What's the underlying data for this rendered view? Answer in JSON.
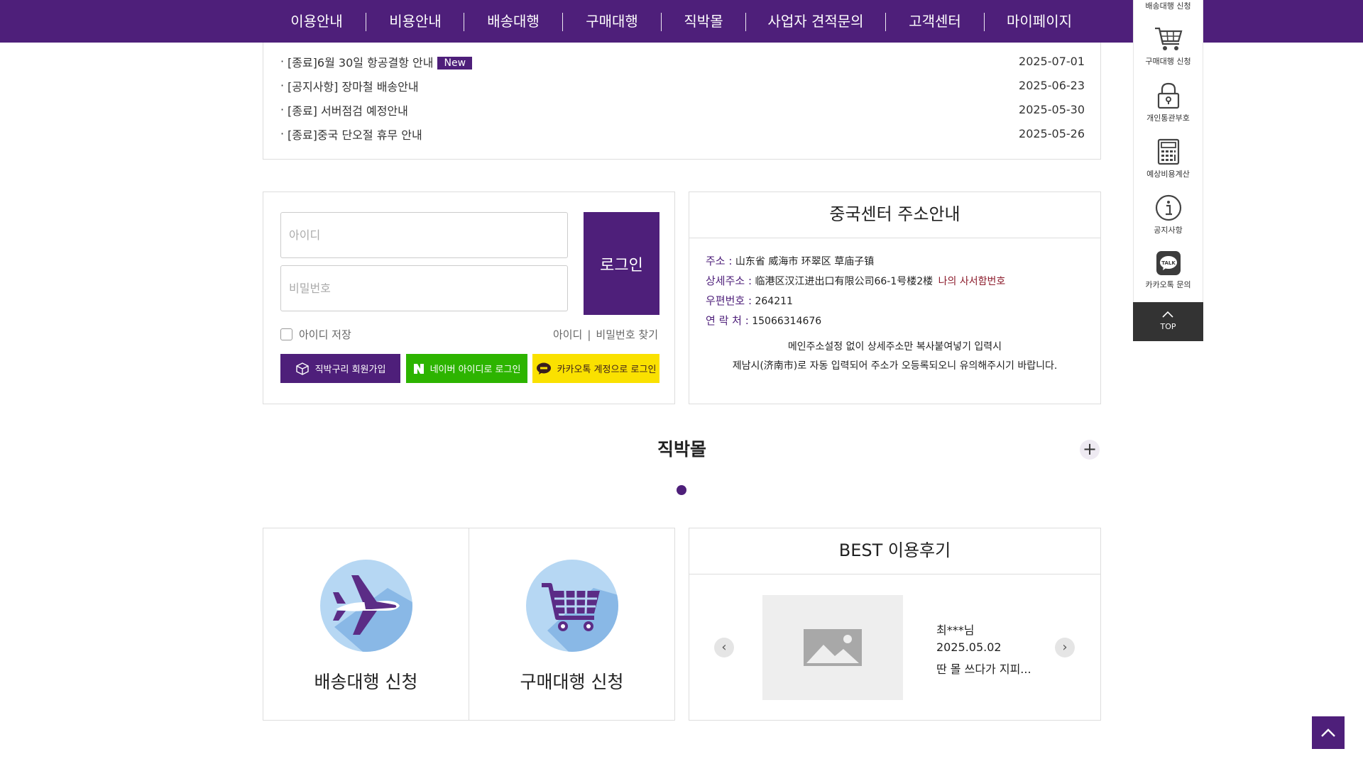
{
  "nav": {
    "items": [
      "이용안내",
      "비용안내",
      "배송대행",
      "구매대행",
      "직박몰",
      "사업자 견적문의",
      "고객센터",
      "마이페이지"
    ]
  },
  "notices": [
    {
      "title": "[종료]6월 30일 항공결항 안내",
      "new": "New",
      "date": "2025-07-01"
    },
    {
      "title": "[공지사항] 장마철 배송안내",
      "new": "",
      "date": "2025-06-23"
    },
    {
      "title": "[종료] 서버점검 예정안내",
      "new": "",
      "date": "2025-05-30"
    },
    {
      "title": "[종료]중국 단오절 휴무 안내",
      "new": "",
      "date": "2025-05-26"
    }
  ],
  "notice_bullet": "·",
  "login": {
    "id_placeholder": "아이디",
    "pw_placeholder": "비밀번호",
    "login_label": "로그인",
    "save_id_label": "아이디 저장",
    "find_id_label": "아이디",
    "find_sep": "|",
    "find_pw_label": "비밀번호 찾기",
    "join_label": "직박구리 회원가입",
    "naver_label": "네이버 아이디로 로그인",
    "kakao_label": "카카오톡 계정으로 로그인"
  },
  "address": {
    "title": "중국센터 주소안내",
    "addr_label": "주소 :",
    "addr_value": "山东省 威海市 环翠区 草庙子镇",
    "detail_label": "상세주소 :",
    "detail_value": "临港区汉江进出口有限公司66-1号楼2楼",
    "mailbox_label": "나의 사서함번호",
    "zip_label": "우편번호 :",
    "zip_value": "264211",
    "phone_label": "연 락 처 :",
    "phone_value": "15066314676",
    "note1": "메인주소설정 없이 상세주소만 복사붙여넣기 입력시",
    "note2": "제남시(济南市)로 자동 입력되어 주소가 오등록되오니 유의해주시기 바랍니다."
  },
  "mall": {
    "title": "직박몰",
    "plus": "+"
  },
  "services": [
    {
      "label": "배송대행 신청",
      "icon": "airplane-icon"
    },
    {
      "label": "구매대행 신청",
      "icon": "cart-icon"
    }
  ],
  "reviews": {
    "title": "BEST 이용후기",
    "prev": "‹",
    "next": "›",
    "author": "최***님",
    "date": "2025.05.02",
    "excerpt": "딴 몰 쓰다가 지피..."
  },
  "quick": {
    "items": [
      {
        "label": "배송대행 신청",
        "icon": "box-icon"
      },
      {
        "label": "구매대행 신청",
        "icon": "cart-icon"
      },
      {
        "label": "개인통관부호",
        "icon": "lock-icon"
      },
      {
        "label": "예상비용계산",
        "icon": "calculator-icon"
      },
      {
        "label": "공지사항",
        "icon": "info-icon"
      },
      {
        "label": "카카오톡 문의",
        "icon": "kakao-talk-icon"
      }
    ],
    "top_label": "TOP",
    "kakao_badge": "TALK"
  },
  "colors": {
    "brand": "#4e1f7a",
    "naver": "#2db400",
    "kakao": "#fae100",
    "mailbox": "#8b1a2a",
    "service_circle": "#b6d7f3"
  }
}
